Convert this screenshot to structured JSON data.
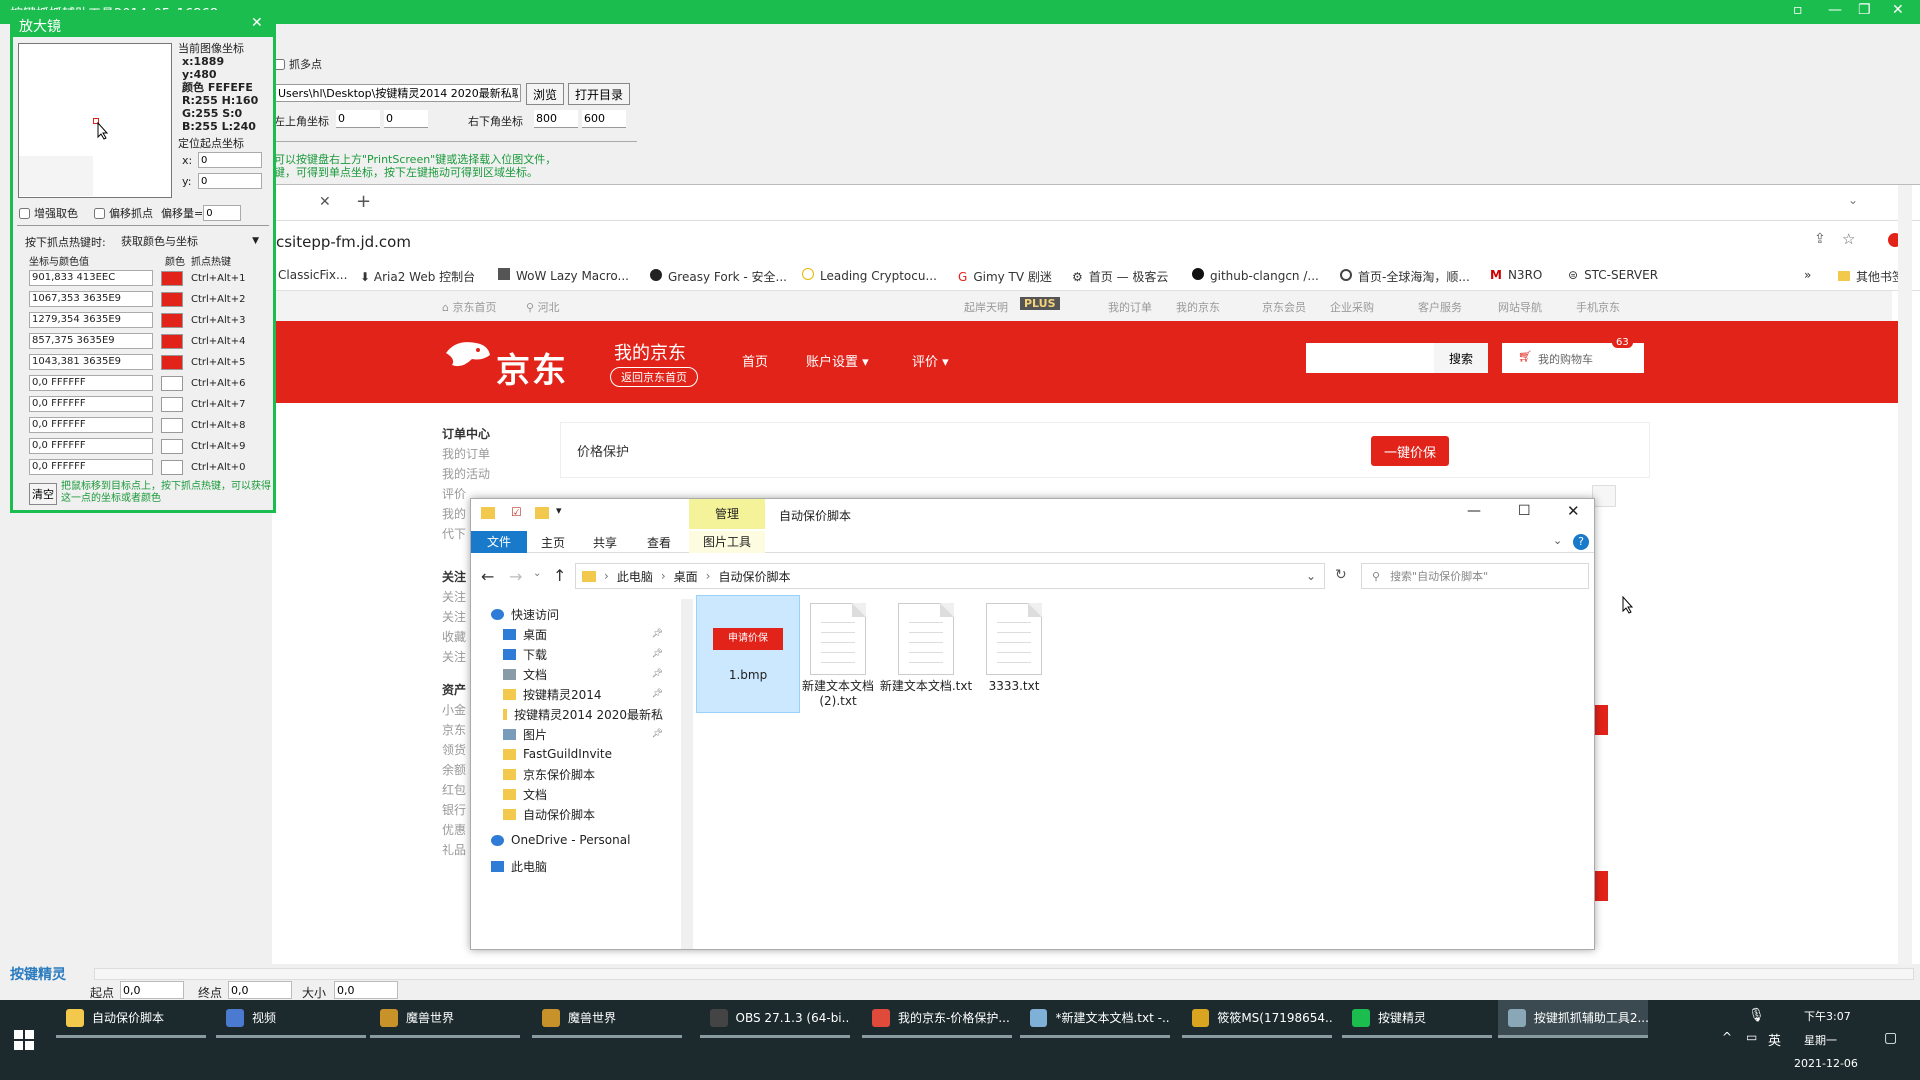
{
  "window": {
    "title": "按键抓抓辅助工具2014_05_16868",
    "controls": [
      "▫",
      "—",
      "❐",
      "✕"
    ]
  },
  "toolpanel": {
    "multi_point": "抓多点",
    "path": "Users\\hl\\Desktop\\按键精灵2014 2020最新私聊\\",
    "browse": "浏览",
    "open_dir": "打开目录",
    "top_left_label": "左上角坐标",
    "tl_x": "0",
    "tl_y": "0",
    "bottom_right_label": "右下角坐标",
    "br_x": "800",
    "br_y": "600",
    "hint1": "可以按键盘右上方\"PrintScreen\"键或选择载入位图文件，",
    "hint2": "键，可得到单点坐标，按下左键拖动可得到区域坐标。"
  },
  "browser": {
    "new_tab": "+",
    "url": "csitepp-fm.jd.com",
    "bookmarks": [
      "ClassicFix...",
      "Aria2 Web 控制台",
      "WoW Lazy Macro...",
      "Greasy Fork - 安全...",
      "Leading Cryptocu...",
      "Gimy TV 剧迷",
      "首页 — 极客云",
      "github-clangcn /...",
      "首页-全球海淘，顺...",
      "N3RO",
      "STC-SERVER"
    ],
    "more": "»",
    "other_bookmarks": "其他书签"
  },
  "jd": {
    "top_home": "京东首页",
    "top_loc": "河北",
    "top_links": [
      "起岸天明",
      "PLUS",
      "我的订单",
      "我的京东",
      "京东会员",
      "企业采购",
      "客户服务",
      "网站导航",
      "手机京东"
    ],
    "logo": "京东",
    "my_jd": "我的京东",
    "back_home": "返回京东首页",
    "nav": [
      "首页",
      "账户设置",
      "评价"
    ],
    "search_btn": "搜索",
    "cart": "我的购物车",
    "cart_count": "63",
    "side": [
      {
        "t": "订单中心",
        "h": true
      },
      {
        "t": "我的订单"
      },
      {
        "t": "我的活动"
      },
      {
        "t": "评价"
      },
      {
        "t": "我的"
      },
      {
        "t": "代下"
      },
      {
        "t": "关注",
        "h": true
      },
      {
        "t": "关注"
      },
      {
        "t": "关注"
      },
      {
        "t": "收藏"
      },
      {
        "t": "关注"
      },
      {
        "t": "资产",
        "h": true
      },
      {
        "t": "小金"
      },
      {
        "t": "京东"
      },
      {
        "t": "领货"
      },
      {
        "t": "余额"
      },
      {
        "t": "红包"
      },
      {
        "t": "银行"
      },
      {
        "t": "优惠"
      },
      {
        "t": "礼品"
      }
    ],
    "price_protect": "价格保护",
    "one_click": "一键价保"
  },
  "explorer": {
    "manage": "管理",
    "title": "自动保价脚本",
    "ribbon": [
      "文件",
      "主页",
      "共享",
      "查看",
      "图片工具"
    ],
    "breadcrumb": [
      "此电脑",
      "桌面",
      "自动保价脚本"
    ],
    "search_placeholder": "搜索\"自动保价脚本\"",
    "tree": [
      {
        "t": "快速访问",
        "pin": false,
        "i": "star",
        "d": 0
      },
      {
        "t": "桌面",
        "pin": true,
        "i": "desk",
        "d": 1
      },
      {
        "t": "下载",
        "pin": true,
        "i": "down",
        "d": 1
      },
      {
        "t": "文档",
        "pin": true,
        "i": "doc",
        "d": 1
      },
      {
        "t": "按键精灵2014",
        "pin": true,
        "i": "folder",
        "d": 1
      },
      {
        "t": "按键精灵2014 2020最新私",
        "pin": true,
        "i": "folder",
        "d": 1
      },
      {
        "t": "图片",
        "pin": true,
        "i": "pic",
        "d": 1
      },
      {
        "t": "FastGuildInvite",
        "pin": false,
        "i": "folder",
        "d": 1
      },
      {
        "t": "京东保价脚本",
        "pin": false,
        "i": "folder",
        "d": 1
      },
      {
        "t": "文档",
        "pin": false,
        "i": "folder",
        "d": 1
      },
      {
        "t": "自动保价脚本",
        "pin": false,
        "i": "folder",
        "d": 1
      },
      {
        "t": "OneDrive - Personal",
        "pin": false,
        "i": "cloud",
        "d": 0
      },
      {
        "t": "此电脑",
        "pin": false,
        "i": "pc",
        "d": 0
      }
    ],
    "files": [
      {
        "name": "1.bmp",
        "thumb": "申请价保",
        "selected": true
      },
      {
        "name": "新建文本文档 (2).txt",
        "thumb": "",
        "selected": false
      },
      {
        "name": "新建文本文档.txt",
        "thumb": "",
        "selected": false
      },
      {
        "name": "3333.txt",
        "thumb": "",
        "selected": false
      }
    ]
  },
  "magnifier": {
    "title": "放大镜",
    "close": "✕",
    "coord_title": "当前图像坐标",
    "x": "x:1889",
    "y": "y:480",
    "color": "颜色 FEFEFE",
    "rh": "R:255  H:160",
    "gs": "G:255  S:0",
    "bl": "B:255  L:240",
    "origin_title": "定位起点坐标",
    "ox_label": "x:",
    "ox": "0",
    "oy_label": "y:",
    "oy": "0",
    "enhance": "增强取色",
    "offset_grab": "偏移抓点",
    "offset_label": "偏移量=",
    "offset_value": "0",
    "hotkey_label": "按下抓点热键时:",
    "hotkey_mode": "获取颜色与坐标",
    "col_coord": "坐标与颜色值",
    "col_color": "颜色",
    "col_hotkey": "抓点热键",
    "rows": [
      {
        "v": "901,833  413EEC",
        "c": "#e2231a",
        "k": "Ctrl+Alt+1"
      },
      {
        "v": "1067,353  3635E9",
        "c": "#e2231a",
        "k": "Ctrl+Alt+2"
      },
      {
        "v": "1279,354  3635E9",
        "c": "#e2231a",
        "k": "Ctrl+Alt+3"
      },
      {
        "v": "857,375  3635E9",
        "c": "#e2231a",
        "k": "Ctrl+Alt+4"
      },
      {
        "v": "1043,381  3635E9",
        "c": "#e2231a",
        "k": "Ctrl+Alt+5"
      },
      {
        "v": "0,0  FFFFFF",
        "c": "#ffffff",
        "k": "Ctrl+Alt+6"
      },
      {
        "v": "0,0  FFFFFF",
        "c": "#ffffff",
        "k": "Ctrl+Alt+7"
      },
      {
        "v": "0,0  FFFFFF",
        "c": "#ffffff",
        "k": "Ctrl+Alt+8"
      },
      {
        "v": "0,0  FFFFFF",
        "c": "#ffffff",
        "k": "Ctrl+Alt+9"
      },
      {
        "v": "0,0  FFFFFF",
        "c": "#ffffff",
        "k": "Ctrl+Alt+0"
      }
    ],
    "clear": "清空",
    "tip": "把鼠标移到目标点上，按下抓点热键，可以获得这一点的坐标或者颜色"
  },
  "statusbar": {
    "brand": "按键精灵",
    "start_label": "起点",
    "start": "0,0",
    "end_label": "终点",
    "end": "0,0",
    "size_label": "大小",
    "size": "0,0"
  },
  "taskbar": {
    "items": [
      {
        "t": "自动保价脚本",
        "c": "#f2c94c"
      },
      {
        "t": "视频",
        "c": "#4a7bd1"
      },
      {
        "t": "魔兽世界",
        "c": "#c7922a"
      },
      {
        "t": "魔兽世界",
        "c": "#c7922a"
      },
      {
        "t": "OBS 27.1.3 (64-bi...",
        "c": "#444444"
      },
      {
        "t": "我的京东-价格保护...",
        "c": "#e04a3b"
      },
      {
        "t": "*新建文本文档.txt -...",
        "c": "#7fb0d8"
      },
      {
        "t": "筱筱MS(17198654...",
        "c": "#d9a520"
      },
      {
        "t": "按键精灵",
        "c": "#1bbd4f"
      },
      {
        "t": "按键抓抓辅助工具2...",
        "c": "#8aa7b8"
      }
    ],
    "ime": "英",
    "time": "下午3:07",
    "weekday": "星期一",
    "date": "2021-12-06"
  },
  "colors": {
    "green": "#1bbd4f",
    "jd_red": "#e2231a",
    "taskbar": "#1c2a2e"
  }
}
